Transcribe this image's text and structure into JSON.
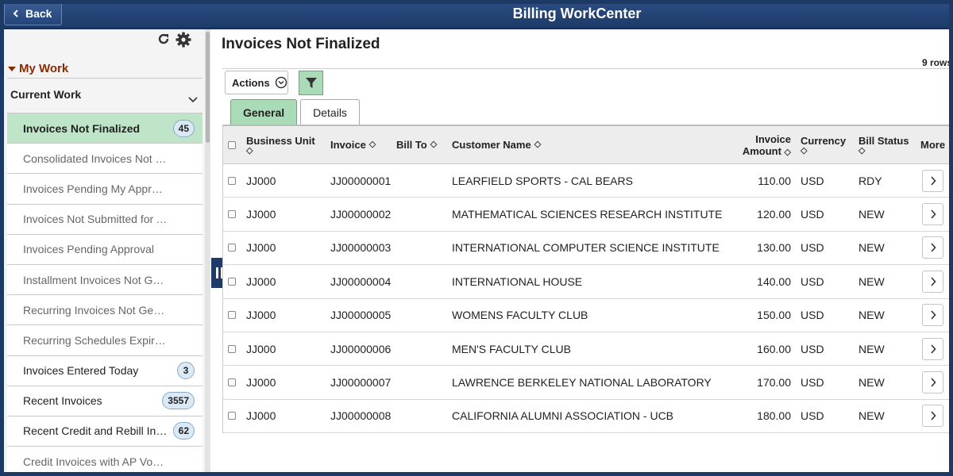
{
  "header": {
    "back_label": "Back",
    "title": "Billing WorkCenter"
  },
  "sidebar": {
    "section_title": "My Work",
    "group_title": "Current Work",
    "items": [
      {
        "label": "Invoices Not Finalized",
        "badge": "45",
        "state": "active"
      },
      {
        "label": "Consolidated Invoices Not Finalized",
        "badge": "",
        "state": "muted"
      },
      {
        "label": "Invoices Pending My Approval",
        "badge": "",
        "state": "muted"
      },
      {
        "label": "Invoices Not Submitted for Approval",
        "badge": "",
        "state": "muted"
      },
      {
        "label": "Invoices Pending Approval",
        "badge": "",
        "state": "muted"
      },
      {
        "label": "Installment Invoices Not Generated",
        "badge": "",
        "state": "muted"
      },
      {
        "label": "Recurring Invoices Not Generated",
        "badge": "",
        "state": "muted"
      },
      {
        "label": "Recurring Schedules Expiring",
        "badge": "",
        "state": "muted"
      },
      {
        "label": "Invoices Entered Today",
        "badge": "3",
        "state": "normal"
      },
      {
        "label": "Recent Invoices",
        "badge": "3557",
        "state": "normal"
      },
      {
        "label": "Recent Credit and Rebill Invoices",
        "badge": "62",
        "state": "normal"
      },
      {
        "label": "Credit Invoices with AP Vouchers",
        "badge": "",
        "state": "muted"
      }
    ]
  },
  "main": {
    "title": "Invoices Not Finalized",
    "row_count": "9 rows",
    "actions_label": "Actions",
    "tabs": [
      {
        "label": "General",
        "active": true
      },
      {
        "label": "Details",
        "active": false
      }
    ],
    "columns": {
      "business_unit": "Business Unit",
      "invoice": "Invoice",
      "bill_to": "Bill To",
      "customer_name": "Customer Name",
      "invoice_amount": "Invoice Amount",
      "currency": "Currency",
      "bill_status": "Bill Status",
      "more": "More"
    },
    "rows": [
      {
        "bu": "JJ000",
        "invoice": "JJ00000001",
        "bill_to": "",
        "customer": "LEARFIELD SPORTS - CAL BEARS",
        "amount": "110.00",
        "currency": "USD",
        "status": "RDY"
      },
      {
        "bu": "JJ000",
        "invoice": "JJ00000002",
        "bill_to": "",
        "customer": "MATHEMATICAL SCIENCES RESEARCH INSTITUTE",
        "amount": "120.00",
        "currency": "USD",
        "status": "NEW"
      },
      {
        "bu": "JJ000",
        "invoice": "JJ00000003",
        "bill_to": "",
        "customer": "INTERNATIONAL COMPUTER SCIENCE INSTITUTE",
        "amount": "130.00",
        "currency": "USD",
        "status": "NEW"
      },
      {
        "bu": "JJ000",
        "invoice": "JJ00000004",
        "bill_to": "",
        "customer": "INTERNATIONAL HOUSE",
        "amount": "140.00",
        "currency": "USD",
        "status": "NEW"
      },
      {
        "bu": "JJ000",
        "invoice": "JJ00000005",
        "bill_to": "",
        "customer": "WOMENS FACULTY CLUB",
        "amount": "150.00",
        "currency": "USD",
        "status": "NEW"
      },
      {
        "bu": "JJ000",
        "invoice": "JJ00000006",
        "bill_to": "",
        "customer": "MEN'S FACULTY CLUB",
        "amount": "160.00",
        "currency": "USD",
        "status": "NEW"
      },
      {
        "bu": "JJ000",
        "invoice": "JJ00000007",
        "bill_to": "",
        "customer": "LAWRENCE BERKELEY NATIONAL LABORATORY",
        "amount": "170.00",
        "currency": "USD",
        "status": "NEW"
      },
      {
        "bu": "JJ000",
        "invoice": "JJ00000008",
        "bill_to": "",
        "customer": "CALIFORNIA ALUMNI ASSOCIATION - UCB",
        "amount": "180.00",
        "currency": "USD",
        "status": "NEW"
      }
    ]
  },
  "icons": {
    "back": "chevron-left-icon",
    "refresh": "refresh-icon",
    "settings": "gear-icon",
    "collapse": "chevron-down-icon",
    "actions": "chevron-down-circle-icon",
    "filter": "filter-icon",
    "pin": "pause-icon",
    "more": "chevron-right-icon"
  },
  "colors": {
    "header": "#1e3a68",
    "active_green": "#aadbb7",
    "my_work": "#8b2a00",
    "badge": "#dbe9f5"
  }
}
